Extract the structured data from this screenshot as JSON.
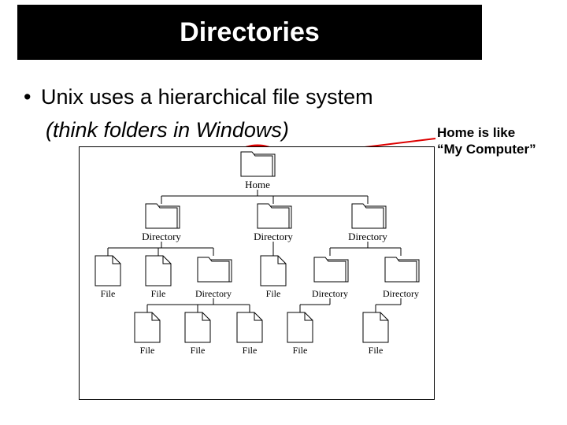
{
  "title": "Directories",
  "bullet_text": "Unix uses a hierarchical file system",
  "sub_text": "(think folders in Windows)",
  "annotation_line1": "Home is like",
  "annotation_line2": "“My Computer”",
  "tree": {
    "root": "Home",
    "level1": {
      "a": "Directory",
      "b": "Directory",
      "c": "Directory"
    },
    "level2": {
      "a1": "File",
      "a2": "File",
      "a3": "Directory",
      "b1": "File",
      "c1": "Directory",
      "c2": "Directory"
    },
    "level3": {
      "a3_1": "File",
      "a3_2": "File",
      "a3_3": "File",
      "b1_or_c1": "File",
      "c2_1": "File"
    }
  }
}
